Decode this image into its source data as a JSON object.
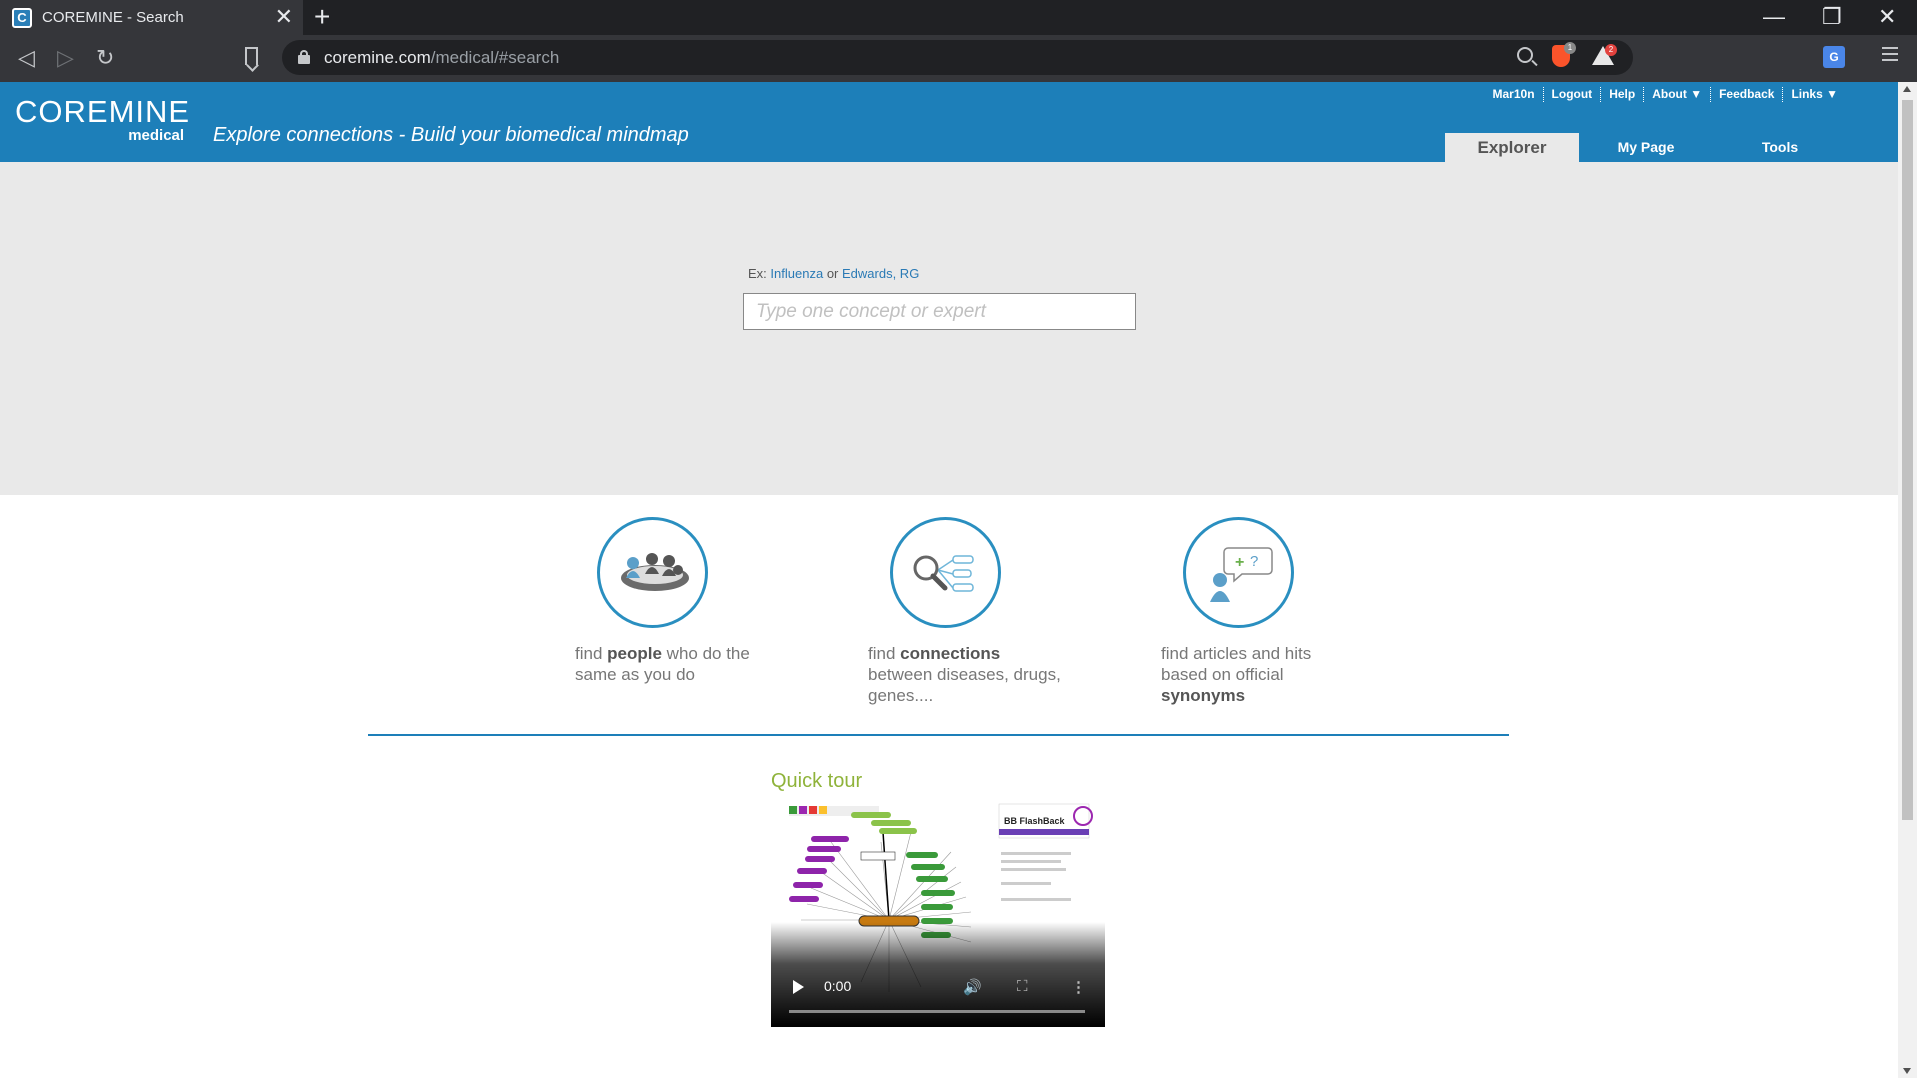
{
  "browser": {
    "tab_title": "COREMINE - Search",
    "tab_close": "✕",
    "new_tab": "+",
    "url_domain": "coremine.com",
    "url_path": "/medical/#search",
    "brave_badge": "1",
    "rewards_badge": "2",
    "window_controls": {
      "minimize": "—",
      "restore": "❐",
      "close": "✕"
    }
  },
  "header": {
    "logo_main": "COREMINE",
    "logo_sub": "medical",
    "tagline": "Explore connections - Build your biomedical mindmap",
    "top_links": [
      "Mar10n",
      "Logout",
      "Help",
      "About ▼",
      "Feedback",
      "Links ▼"
    ],
    "tabs": [
      {
        "label": "Explorer",
        "active": true
      },
      {
        "label": "My Page",
        "active": false
      },
      {
        "label": "Tools",
        "active": false
      }
    ]
  },
  "search": {
    "examples_prefix": "Ex:",
    "example_1": "Influenza",
    "examples_or": "or",
    "example_2": "Edwards, RG",
    "placeholder": "Type one concept or expert"
  },
  "features": [
    {
      "pre": "find ",
      "bold": "people",
      "post": " who do the same as you do"
    },
    {
      "pre": "find ",
      "bold": "connections",
      "post": " between diseases, drugs, genes...."
    },
    {
      "pre": "find articles and hits based on official ",
      "bold": "synonyms",
      "post": ""
    }
  ],
  "quick_tour": {
    "label": "Quick tour",
    "time": "0:00",
    "preview_title": "BB FlashBack"
  },
  "colors": {
    "brand_blue": "#1d7fb9",
    "band_gray": "#e9e9e9",
    "quicktour_green": "#8fb33a"
  }
}
